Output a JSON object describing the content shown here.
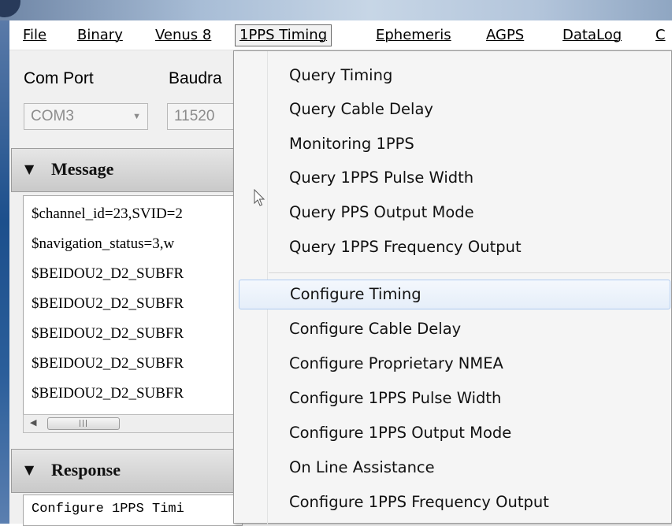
{
  "menubar": {
    "items": [
      {
        "label": "File",
        "mnemonic": "F"
      },
      {
        "label": "Binary",
        "mnemonic": "B"
      },
      {
        "label": "Venus 8",
        "mnemonic": "V"
      },
      {
        "label": "1PPS Timing",
        "mnemonic": "1",
        "active": true
      },
      {
        "label": "Ephemeris",
        "mnemonic": "E"
      },
      {
        "label": "AGPS",
        "mnemonic": "A"
      },
      {
        "label": "DataLog",
        "mnemonic": "D"
      },
      {
        "label": "C",
        "mnemonic": "C"
      }
    ]
  },
  "settings": {
    "com_port_label": "Com Port",
    "baudrate_label": "Baudra",
    "com_port_value": "COM3",
    "baudrate_value": "11520"
  },
  "message_panel": {
    "title": "Message",
    "lines": [
      "$channel_id=23,SVID=2",
      "$navigation_status=3,w",
      "$BEIDOU2_D2_SUBFR",
      "$BEIDOU2_D2_SUBFR",
      "$BEIDOU2_D2_SUBFR",
      "$BEIDOU2_D2_SUBFR",
      "$BEIDOU2_D2_SUBFR"
    ]
  },
  "response_panel": {
    "title": "Response",
    "text": "Configure 1PPS Timi"
  },
  "timing_menu": {
    "group1": [
      "Query Timing",
      "Query Cable Delay",
      "Monitoring 1PPS",
      "Query 1PPS Pulse Width",
      "Query PPS Output Mode",
      "Query 1PPS Frequency Output"
    ],
    "group2": [
      "Configure Timing",
      "Configure Cable Delay",
      "Configure Proprietary NMEA",
      "Configure 1PPS Pulse Width",
      "Configure 1PPS Output Mode",
      "On Line Assistance",
      "Configure 1PPS Frequency Output"
    ],
    "highlighted": "Configure Timing"
  },
  "icons": {
    "collapse": "triangle-down-icon",
    "combo_arrow": "chevron-down-icon",
    "scroll_left": "arrow-left-icon",
    "cursor": "mouse-pointer-icon"
  },
  "colors": {
    "highlight_border": "#aecbf1",
    "highlight_fill": "#e5eef9",
    "menu_bg": "#f5f5f5",
    "panel_header": "#c9c9c9"
  }
}
